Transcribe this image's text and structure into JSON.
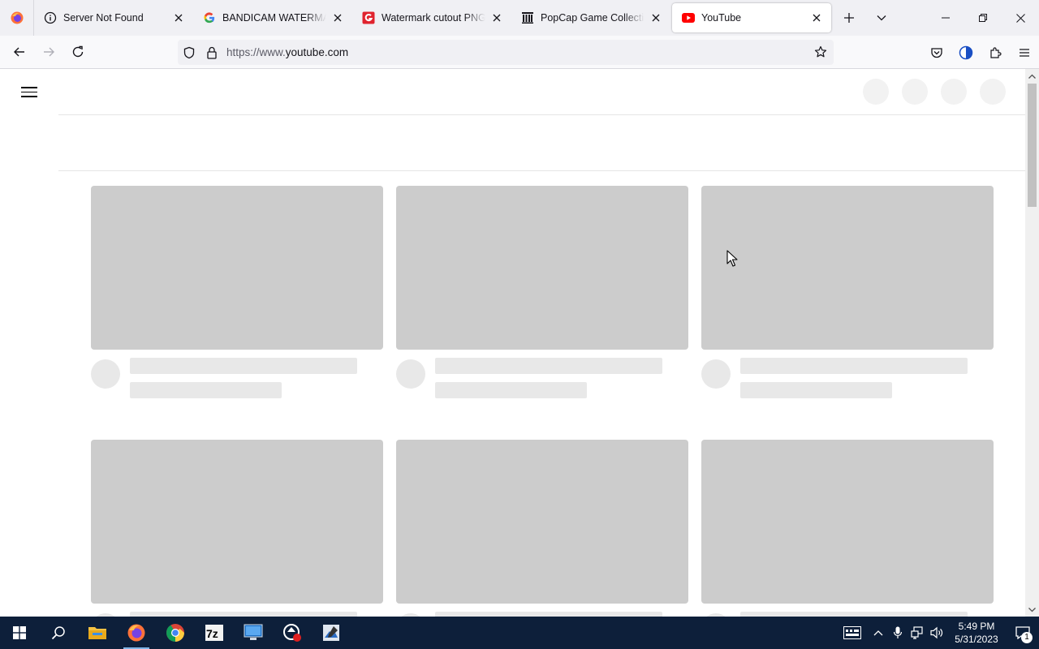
{
  "browser": {
    "tabs": [
      {
        "title": "Server Not Found",
        "favicon": "info-icon"
      },
      {
        "title": "BANDICAM WATERMARK",
        "favicon": "google-icon"
      },
      {
        "title": "Watermark cutout PNG & ",
        "favicon": "g-red-icon"
      },
      {
        "title": "PopCap Game Collection",
        "favicon": "archive-icon"
      },
      {
        "title": "YouTube",
        "favicon": "youtube-icon",
        "active": true
      }
    ],
    "url": {
      "prefix": "https://www.",
      "host": "youtube.com"
    }
  },
  "colors": {
    "skeleton_thumb": "#cccccc",
    "skeleton_line": "#e8e8e8",
    "taskbar": "#0d1f3a",
    "youtube_red": "#ff0000"
  },
  "taskbar": {
    "apps": [
      "file-explorer-icon",
      "firefox-icon",
      "chrome-icon",
      "7zip-icon",
      "remote-desktop-icon",
      "bandicam-icon",
      "image-editor-icon"
    ],
    "time": "5:49 PM",
    "date": "5/31/2023",
    "notification_count": "1"
  }
}
